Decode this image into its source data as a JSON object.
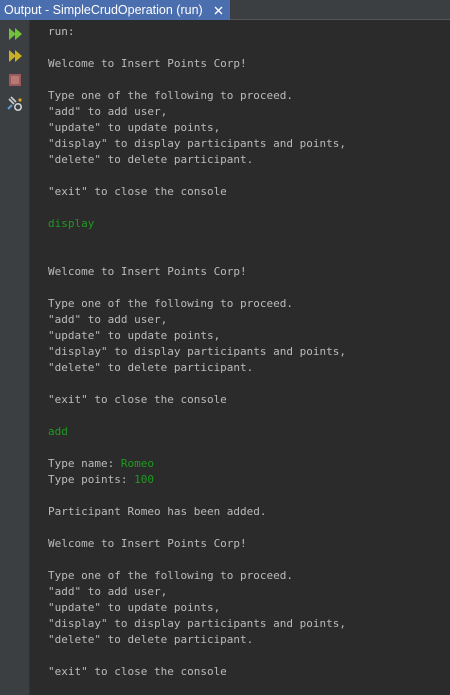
{
  "tab": {
    "title": "Output - SimpleCrudOperation (run)"
  },
  "toolbar": {
    "icons": [
      "rerun-icon",
      "rerun-with-options-icon",
      "stop-icon",
      "settings-icon"
    ]
  },
  "colors": {
    "background": "#2b2b2b",
    "text": "#bbbbbb",
    "user_input": "#1f9a1f",
    "tab_active": "#4b6eaf"
  },
  "console": {
    "lines": [
      {
        "text": "run:"
      },
      {
        "text": ""
      },
      {
        "text": "Welcome to Insert Points Corp!"
      },
      {
        "text": ""
      },
      {
        "text": "Type one of the following to proceed."
      },
      {
        "text": "\"add\" to add user,"
      },
      {
        "text": "\"update\" to update points,"
      },
      {
        "text": "\"display\" to display participants and points,"
      },
      {
        "text": "\"delete\" to delete participant."
      },
      {
        "text": ""
      },
      {
        "text": "\"exit\" to close the console"
      },
      {
        "text": ""
      },
      {
        "text": "display",
        "input": true
      },
      {
        "text": ""
      },
      {
        "text": ""
      },
      {
        "text": "Welcome to Insert Points Corp!"
      },
      {
        "text": ""
      },
      {
        "text": "Type one of the following to proceed."
      },
      {
        "text": "\"add\" to add user,"
      },
      {
        "text": "\"update\" to update points,"
      },
      {
        "text": "\"display\" to display participants and points,"
      },
      {
        "text": "\"delete\" to delete participant."
      },
      {
        "text": ""
      },
      {
        "text": "\"exit\" to close the console"
      },
      {
        "text": ""
      },
      {
        "text": "add",
        "input": true
      },
      {
        "text": ""
      },
      {
        "text": "Type name: ",
        "input_text": "Romeo"
      },
      {
        "text": "Type points: ",
        "input_text": "100"
      },
      {
        "text": ""
      },
      {
        "text": "Participant Romeo has been added."
      },
      {
        "text": ""
      },
      {
        "text": "Welcome to Insert Points Corp!"
      },
      {
        "text": ""
      },
      {
        "text": "Type one of the following to proceed."
      },
      {
        "text": "\"add\" to add user,"
      },
      {
        "text": "\"update\" to update points,"
      },
      {
        "text": "\"display\" to display participants and points,"
      },
      {
        "text": "\"delete\" to delete participant."
      },
      {
        "text": ""
      },
      {
        "text": "\"exit\" to close the console"
      }
    ]
  }
}
